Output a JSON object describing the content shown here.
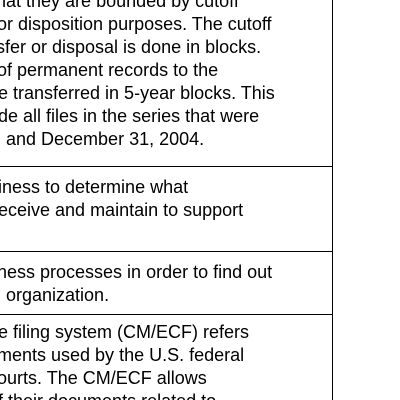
{
  "rows": [
    {
      "lines": [
        "hat they are bounded by cutoff",
        "or disposition purposes. The cutoff",
        "sfer or disposal is done in blocks.",
        "of permanent records to the",
        "e transferred in 5-year blocks. This",
        "de all files in the series that were",
        "and December 31, 2004."
      ]
    },
    {
      "lines": [
        "iness to determine what",
        "eceive and maintain to support"
      ]
    },
    {
      "lines": [
        "ness processes in order to find out",
        "organization."
      ]
    },
    {
      "lines": [
        "e filing system (CM/ECF) refers",
        "ments used by the U.S. federal",
        "ourts. The CM/ECF allows",
        "f their documents related to"
      ]
    }
  ]
}
